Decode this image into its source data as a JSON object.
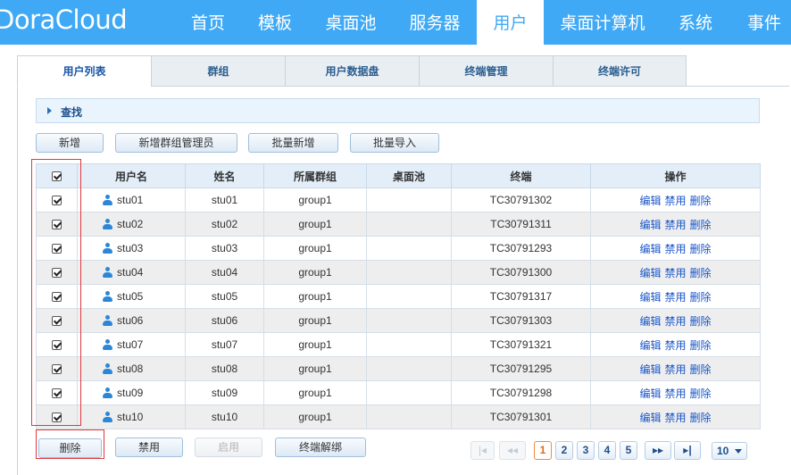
{
  "app": {
    "logo": "DoraCloud"
  },
  "nav": [
    {
      "label": "首页"
    },
    {
      "label": "模板"
    },
    {
      "label": "桌面池"
    },
    {
      "label": "服务器"
    },
    {
      "label": "用户",
      "active": true
    },
    {
      "label": "桌面计算机"
    },
    {
      "label": "系统"
    },
    {
      "label": "事件"
    }
  ],
  "tabs": [
    {
      "label": "用户列表",
      "active": true
    },
    {
      "label": "群组"
    },
    {
      "label": "用户数据盘"
    },
    {
      "label": "终端管理"
    },
    {
      "label": "终端许可"
    }
  ],
  "search": {
    "label": "查找"
  },
  "toolbar": {
    "add": "新增",
    "add_group_admin": "新增群组管理员",
    "batch_add": "批量新增",
    "batch_import": "批量导入"
  },
  "table": {
    "header_checked": true,
    "columns": [
      "用户名",
      "姓名",
      "所属群组",
      "桌面池",
      "终端",
      "操作"
    ],
    "actions": [
      "编辑",
      "禁用",
      "删除"
    ],
    "rows": [
      {
        "checked": true,
        "username": "stu01",
        "name": "stu01",
        "group": "group1",
        "pool": "",
        "terminal": "TC30791302"
      },
      {
        "checked": true,
        "username": "stu02",
        "name": "stu02",
        "group": "group1",
        "pool": "",
        "terminal": "TC30791311"
      },
      {
        "checked": true,
        "username": "stu03",
        "name": "stu03",
        "group": "group1",
        "pool": "",
        "terminal": "TC30791293"
      },
      {
        "checked": true,
        "username": "stu04",
        "name": "stu04",
        "group": "group1",
        "pool": "",
        "terminal": "TC30791300"
      },
      {
        "checked": true,
        "username": "stu05",
        "name": "stu05",
        "group": "group1",
        "pool": "",
        "terminal": "TC30791317"
      },
      {
        "checked": true,
        "username": "stu06",
        "name": "stu06",
        "group": "group1",
        "pool": "",
        "terminal": "TC30791303"
      },
      {
        "checked": true,
        "username": "stu07",
        "name": "stu07",
        "group": "group1",
        "pool": "",
        "terminal": "TC30791321"
      },
      {
        "checked": true,
        "username": "stu08",
        "name": "stu08",
        "group": "group1",
        "pool": "",
        "terminal": "TC30791295"
      },
      {
        "checked": true,
        "username": "stu09",
        "name": "stu09",
        "group": "group1",
        "pool": "",
        "terminal": "TC30791298"
      },
      {
        "checked": true,
        "username": "stu10",
        "name": "stu10",
        "group": "group1",
        "pool": "",
        "terminal": "TC30791301"
      }
    ]
  },
  "bottom_toolbar": {
    "delete": "删除",
    "disable": "禁用",
    "enable": "启用",
    "unbind_terminal": "终端解绑"
  },
  "pager": {
    "first": "|◂",
    "prev": "◂◂",
    "pages": [
      "1",
      "2",
      "3",
      "4",
      "5"
    ],
    "current": "1",
    "next": "▸▸",
    "last": "▸|",
    "page_size": "10"
  },
  "colors": {
    "topbar": "#3fa9f5",
    "highlight_box": "#e0393e",
    "link": "#1a56c8"
  }
}
